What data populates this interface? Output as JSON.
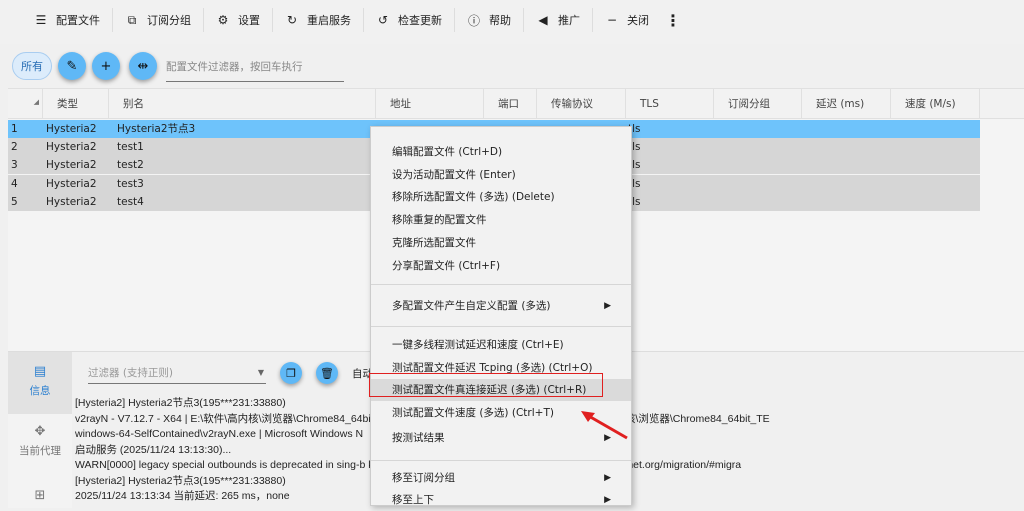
{
  "toolbar": {
    "items": [
      {
        "icon": "server-icon",
        "label": "配置文件"
      },
      {
        "icon": "subscription-icon",
        "label": "订阅分组"
      },
      {
        "icon": "gear-icon",
        "label": "设置"
      },
      {
        "icon": "restart-icon",
        "label": "重启服务"
      },
      {
        "icon": "update-icon",
        "label": "检查更新"
      },
      {
        "icon": "help-icon",
        "label": "帮助"
      },
      {
        "icon": "speaker-icon",
        "label": "推广"
      },
      {
        "icon": "minimize-icon",
        "label": "关闭"
      }
    ]
  },
  "filterbar": {
    "all_label": "所有",
    "filter_placeholder": "配置文件过滤器，按回车执行"
  },
  "table": {
    "columns": [
      "类型",
      "别名",
      "地址",
      "端口",
      "传输协议",
      "TLS",
      "订阅分组",
      "延迟 (ms)",
      "速度 (M/s)"
    ],
    "rows": [
      {
        "num": "1",
        "type": "Hysteria2",
        "name": "Hysteria2节点3",
        "tls": "tls",
        "selected": true
      },
      {
        "num": "2",
        "type": "Hysteria2",
        "name": "test1",
        "tls": "tls"
      },
      {
        "num": "3",
        "type": "Hysteria2",
        "name": "test2",
        "tls": "tls"
      },
      {
        "num": "4",
        "type": "Hysteria2",
        "name": "test3",
        "tls": "tls"
      },
      {
        "num": "5",
        "type": "Hysteria2",
        "name": "test4",
        "tls": "tls"
      }
    ]
  },
  "bottom": {
    "nav": [
      {
        "label": "信息"
      },
      {
        "label": "当前代理"
      }
    ],
    "log_filter_placeholder": "过滤器 (支持正则)",
    "auto_label": "自动",
    "log": [
      "[Hysteria2] Hysteria2节点3(195***231:33880)",
      "v2rayN - V7.12.7 - X64 | E:\\软件\\高内核\\浏览器\\Chrome84_64bit                                                                          2.7\\v2rayN-windows-64-SelfContained\\ | E:\\软件\\高内核\\浏览器\\Chrome84_64bit_TE",
      "windows-64-SelfContained\\v2rayN.exe | Microsoft Windows N",
      "启动服务 (2025/11/24 13:13:30)...",
      "WARN[0000] legacy special outbounds is deprecated in sing-b                                                                               kout documentation for migration: https://sing-box.sagernet.org/migration/#migra",
      "[Hysteria2] Hysteria2节点3(195***231:33880)",
      "2025/11/24 13:13:34 当前延迟: 265 ms，none"
    ]
  },
  "context_menu": {
    "items": [
      {
        "label": "编辑配置文件 (Ctrl+D)"
      },
      {
        "label": "设为活动配置文件 (Enter)"
      },
      {
        "label": "移除所选配置文件 (多选) (Delete)"
      },
      {
        "label": "移除重复的配置文件"
      },
      {
        "label": "克隆所选配置文件"
      },
      {
        "label": "分享配置文件 (Ctrl+F)"
      },
      {
        "label": "多配置文件产生自定义配置 (多选)",
        "submenu": true
      },
      {
        "label": "一键多线程测试延迟和速度 (Ctrl+E)"
      },
      {
        "label": "测试配置文件延迟 Tcping (多选) (Ctrl+O)"
      },
      {
        "label": "测试配置文件真连接延迟 (多选) (Ctrl+R)",
        "highlighted": true
      },
      {
        "label": "测试配置文件速度 (多选) (Ctrl+T)"
      },
      {
        "label": "按测试结果",
        "submenu": true
      },
      {
        "label": "移至订阅分组",
        "submenu": true
      },
      {
        "label": "移至上下",
        "submenu": true
      }
    ]
  },
  "colors": {
    "selected_row": "#6ec3fb",
    "accent": "#5fb8f6",
    "annotation": "#e02020"
  }
}
